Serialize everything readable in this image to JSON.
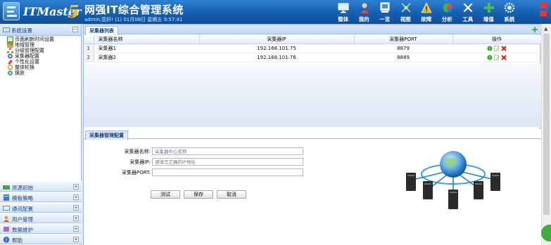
{
  "app": {
    "brand": "ITMaster",
    "version": "5",
    "title": "网强IT综合管理系统",
    "user_line": "admin,您好! (1) 01月08日 星期五 9:57:41"
  },
  "nav": [
    {
      "label": "整体",
      "icon": "monitor-icon"
    },
    {
      "label": "我的",
      "icon": "user-icon"
    },
    {
      "label": "一览",
      "icon": "overview-icon"
    },
    {
      "label": "视图",
      "icon": "topology-icon"
    },
    {
      "label": "故障",
      "icon": "warning-icon"
    },
    {
      "label": "分析",
      "icon": "pie-chart-icon"
    },
    {
      "label": "工具",
      "icon": "tools-icon"
    },
    {
      "label": "增值",
      "icon": "plus-icon"
    },
    {
      "label": "系统",
      "icon": "gear-icon"
    }
  ],
  "sidebar": {
    "header": "系统设置",
    "items": [
      {
        "label": "页面刷新时间设置",
        "icon": "refresh-icon"
      },
      {
        "label": "地域管理",
        "icon": "map-icon"
      },
      {
        "label": "分级管理配置",
        "icon": "hierarchy-icon"
      },
      {
        "label": "采集器配置",
        "icon": "collector-icon"
      },
      {
        "label": "个性化设置",
        "icon": "personalize-icon"
      },
      {
        "label": "整体轮换",
        "icon": "rotate-icon"
      },
      {
        "label": "换肤",
        "icon": "skin-icon"
      }
    ],
    "sections": [
      {
        "label": "资源初始",
        "icon": "resource-icon"
      },
      {
        "label": "模板策略",
        "icon": "template-icon"
      },
      {
        "label": "通讯配置",
        "icon": "communication-icon"
      },
      {
        "label": "用户管理",
        "icon": "users-icon"
      },
      {
        "label": "数据维护",
        "icon": "database-icon"
      },
      {
        "label": "帮助",
        "icon": "help-icon"
      }
    ]
  },
  "collector_list": {
    "tab": "采集器列表",
    "columns": [
      "采集器名称",
      "采集器IP",
      "采集器PORT",
      "操作"
    ],
    "rows": [
      {
        "num": "1",
        "name": "采集器1",
        "ip": "192.168.101.75",
        "port": "8879"
      },
      {
        "num": "2",
        "name": "采集器2",
        "ip": "192.168.101.76",
        "port": "8889"
      }
    ]
  },
  "config": {
    "tab": "采集器管理配置",
    "name_label": "采集器名称:",
    "name_placeholder": "采集器中心名称",
    "ip_label": "采集器IP:",
    "ip_placeholder": "请填写正确的IP地址",
    "port_label": "采集器PORT:",
    "port_placeholder": "",
    "buttons": {
      "test": "测试",
      "save": "保存",
      "cancel": "取消"
    }
  },
  "colors": {
    "header_blue": "#175fb0",
    "panel_border": "#99bbe8",
    "title_blue": "#15428b",
    "add_green": "#1d9b25"
  }
}
